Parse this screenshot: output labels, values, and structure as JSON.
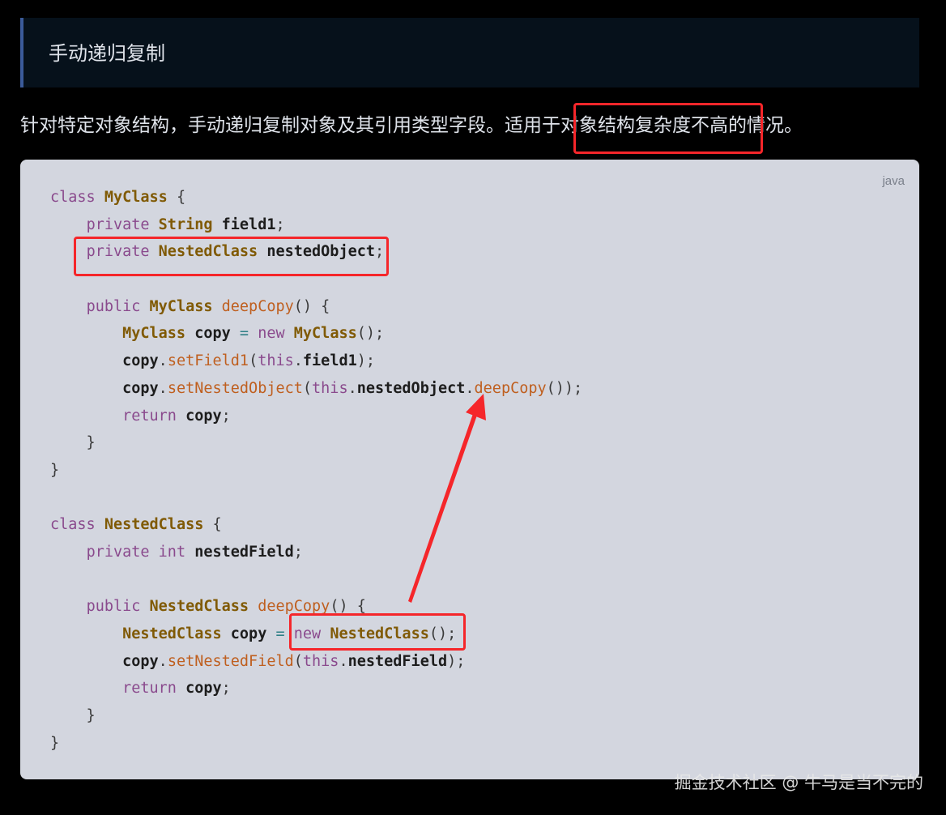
{
  "heading": "手动递归复制",
  "description": "针对特定对象结构，手动递归复制对象及其引用类型字段。适用于对象结构复杂度不高的情况。",
  "code_block": {
    "language": "java",
    "lines": [
      [
        [
          "kw",
          "class"
        ],
        [
          "pu",
          " "
        ],
        [
          "ty",
          "MyClass"
        ],
        [
          "pu",
          " {"
        ]
      ],
      [
        [
          "pu",
          "    "
        ],
        [
          "kw",
          "private"
        ],
        [
          "pu",
          " "
        ],
        [
          "ty",
          "String"
        ],
        [
          "pu",
          " "
        ],
        [
          "id",
          "field1"
        ],
        [
          "pu",
          ";"
        ]
      ],
      [
        [
          "pu",
          "    "
        ],
        [
          "kw",
          "private"
        ],
        [
          "pu",
          " "
        ],
        [
          "ty",
          "NestedClass"
        ],
        [
          "pu",
          " "
        ],
        [
          "id",
          "nestedObject"
        ],
        [
          "pu",
          ";"
        ]
      ],
      [
        [
          "pu",
          ""
        ]
      ],
      [
        [
          "pu",
          "    "
        ],
        [
          "kw",
          "public"
        ],
        [
          "pu",
          " "
        ],
        [
          "ty",
          "MyClass"
        ],
        [
          "pu",
          " "
        ],
        [
          "fn",
          "deepCopy"
        ],
        [
          "pu",
          "() {"
        ]
      ],
      [
        [
          "pu",
          "        "
        ],
        [
          "ty",
          "MyClass"
        ],
        [
          "pu",
          " "
        ],
        [
          "id",
          "copy"
        ],
        [
          "pu",
          " "
        ],
        [
          "op",
          "="
        ],
        [
          "pu",
          " "
        ],
        [
          "kw",
          "new"
        ],
        [
          "pu",
          " "
        ],
        [
          "ty",
          "MyClass"
        ],
        [
          "pu",
          "();"
        ]
      ],
      [
        [
          "pu",
          "        "
        ],
        [
          "id",
          "copy"
        ],
        [
          "pu",
          "."
        ],
        [
          "fn",
          "setField1"
        ],
        [
          "pu",
          "("
        ],
        [
          "kw",
          "this"
        ],
        [
          "pu",
          "."
        ],
        [
          "id",
          "field1"
        ],
        [
          "pu",
          ");"
        ]
      ],
      [
        [
          "pu",
          "        "
        ],
        [
          "id",
          "copy"
        ],
        [
          "pu",
          "."
        ],
        [
          "fn",
          "setNestedObject"
        ],
        [
          "pu",
          "("
        ],
        [
          "kw",
          "this"
        ],
        [
          "pu",
          "."
        ],
        [
          "id",
          "nestedObject"
        ],
        [
          "pu",
          "."
        ],
        [
          "fn",
          "deepCopy"
        ],
        [
          "pu",
          "());"
        ]
      ],
      [
        [
          "pu",
          "        "
        ],
        [
          "kw",
          "return"
        ],
        [
          "pu",
          " "
        ],
        [
          "id",
          "copy"
        ],
        [
          "pu",
          ";"
        ]
      ],
      [
        [
          "pu",
          "    }"
        ]
      ],
      [
        [
          "pu",
          "}"
        ]
      ],
      [
        [
          "pu",
          ""
        ]
      ],
      [
        [
          "kw",
          "class"
        ],
        [
          "pu",
          " "
        ],
        [
          "ty",
          "NestedClass"
        ],
        [
          "pu",
          " {"
        ]
      ],
      [
        [
          "pu",
          "    "
        ],
        [
          "kw",
          "private"
        ],
        [
          "pu",
          " "
        ],
        [
          "kw",
          "int"
        ],
        [
          "pu",
          " "
        ],
        [
          "id",
          "nestedField"
        ],
        [
          "pu",
          ";"
        ]
      ],
      [
        [
          "pu",
          ""
        ]
      ],
      [
        [
          "pu",
          "    "
        ],
        [
          "kw",
          "public"
        ],
        [
          "pu",
          " "
        ],
        [
          "ty",
          "NestedClass"
        ],
        [
          "pu",
          " "
        ],
        [
          "fn",
          "deepCopy"
        ],
        [
          "pu",
          "() {"
        ]
      ],
      [
        [
          "pu",
          "        "
        ],
        [
          "ty",
          "NestedClass"
        ],
        [
          "pu",
          " "
        ],
        [
          "id",
          "copy"
        ],
        [
          "pu",
          " "
        ],
        [
          "op",
          "="
        ],
        [
          "pu",
          " "
        ],
        [
          "kw",
          "new"
        ],
        [
          "pu",
          " "
        ],
        [
          "ty",
          "NestedClass"
        ],
        [
          "pu",
          "();"
        ]
      ],
      [
        [
          "pu",
          "        "
        ],
        [
          "id",
          "copy"
        ],
        [
          "pu",
          "."
        ],
        [
          "fn",
          "setNestedField"
        ],
        [
          "pu",
          "("
        ],
        [
          "kw",
          "this"
        ],
        [
          "pu",
          "."
        ],
        [
          "id",
          "nestedField"
        ],
        [
          "pu",
          ");"
        ]
      ],
      [
        [
          "pu",
          "        "
        ],
        [
          "kw",
          "return"
        ],
        [
          "pu",
          " "
        ],
        [
          "id",
          "copy"
        ],
        [
          "pu",
          ";"
        ]
      ],
      [
        [
          "pu",
          "    }"
        ]
      ],
      [
        [
          "pu",
          "}"
        ]
      ]
    ]
  },
  "annotations": {
    "color": "#f5262a"
  },
  "watermark": "掘金技术社区 @ 牛马是当不完的"
}
